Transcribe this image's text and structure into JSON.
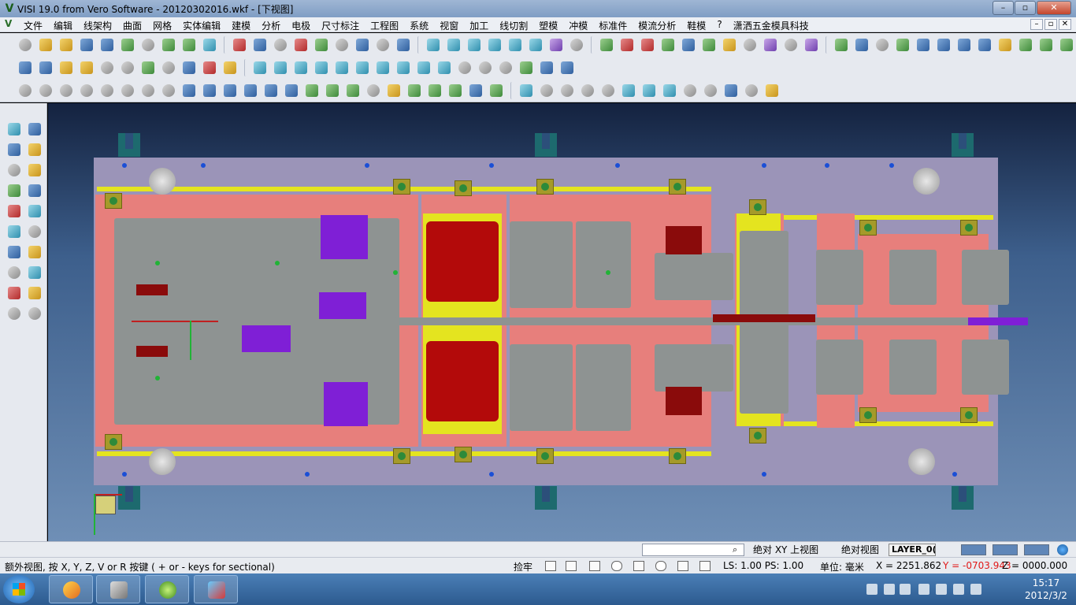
{
  "window": {
    "title": "VISI 19.0  from Vero Software - 20120302016.wkf - [下视图]",
    "buttons": [
      "–",
      "▫",
      "✕"
    ]
  },
  "menu": {
    "items": [
      "文件",
      "编辑",
      "线架构",
      "曲面",
      "网格",
      "实体编辑",
      "建模",
      "分析",
      "电极",
      "尺寸标注",
      "工程图",
      "系统",
      "视窗",
      "加工",
      "线切割",
      "塑模",
      "冲模",
      "标准件",
      "模流分析",
      "鞋模",
      "?",
      "潇洒五金模具科技"
    ],
    "mdi_buttons": [
      "–",
      "▫",
      "✕"
    ]
  },
  "command_bar": {
    "input_value": "",
    "view_left": "绝对 XY 上视图",
    "view_right": "绝对视图",
    "layer": "LAYER_0("
  },
  "status": {
    "prompt": "额外视图, 按 X, Y, Z, V or R 按键 ( + or - keys for sectional)",
    "snap": "捡牢",
    "ls_ps": "LS: 1.00 PS: 1.00",
    "units": "单位: 毫米",
    "x": "X = 2251.862",
    "y": "Y = -0703.943",
    "z": "Z = 0000.000"
  },
  "taskbar": {
    "time": "15:17",
    "date": "2012/3/2"
  },
  "colors": {
    "plate": "#9b94b8",
    "pink_plate": "#e77f7c",
    "part_gray": "#8e9392",
    "purple_insert": "#7f1fd6",
    "yellow_rail": "#e4e41f",
    "red_block": "#b30a0a",
    "y_value": "#e01818"
  }
}
